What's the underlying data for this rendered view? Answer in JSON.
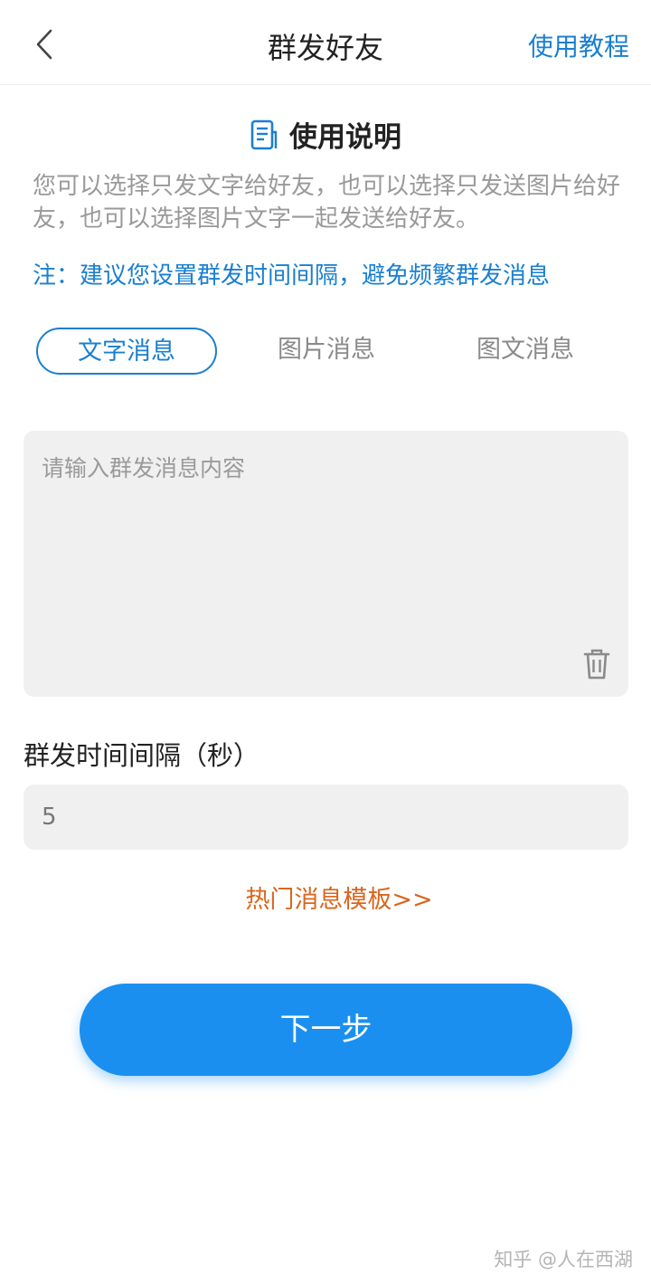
{
  "header": {
    "back_icon": "chevron-left-icon",
    "title": "群发好友",
    "tutorial_label": "使用教程"
  },
  "usage": {
    "icon": "document-icon",
    "title": "使用说明",
    "description": "您可以选择只发文字给好友，也可以选择只发送图片给好友，也可以选择图片文字一起发送给好友。",
    "note": "注：建议您设置群发时间间隔，避免频繁群发消息"
  },
  "tabs": [
    {
      "label": "文字消息",
      "active": true
    },
    {
      "label": "图片消息",
      "active": false
    },
    {
      "label": "图文消息",
      "active": false
    }
  ],
  "message": {
    "placeholder": "请输入群发消息内容",
    "value": "",
    "clear_icon": "trash-icon"
  },
  "interval": {
    "label": "群发时间间隔（秒）",
    "value": "5"
  },
  "templates_link": "热门消息模板>>",
  "next_button": "下一步",
  "watermark": "知乎 @人在西湖",
  "colors": {
    "accent": "#1a7fd0",
    "button": "#1a8ff0",
    "link_orange": "#d9661e",
    "input_bg": "#f0f0f0"
  }
}
